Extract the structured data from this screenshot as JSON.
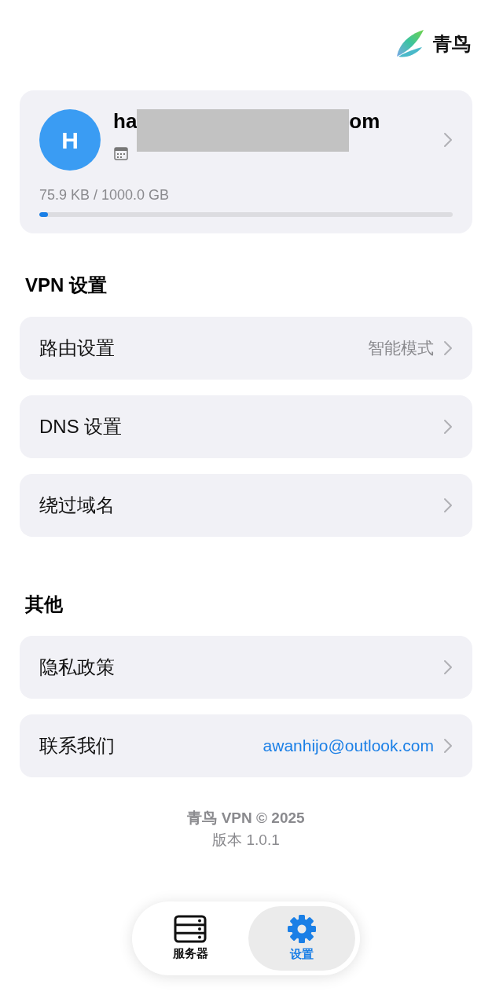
{
  "header": {
    "brand": "青鸟"
  },
  "account": {
    "avatar": "H",
    "email_start": "ha",
    "email_end": "om",
    "usage": "75.9 KB / 1000.0 GB",
    "level": 0.02
  },
  "sections": [
    {
      "title": "VPN 设置",
      "rows": [
        {
          "label": "路由设置",
          "value": "智能模式",
          "kind": "plain"
        },
        {
          "label": "DNS 设置"
        },
        {
          "label": "绕过域名"
        }
      ]
    },
    {
      "title": "其他",
      "rows": [
        {
          "label": "隐私政策"
        },
        {
          "label": "联系我们",
          "value": "awanhijo@outlook.com",
          "kind": "link"
        }
      ]
    }
  ],
  "footer": {
    "copyright": "青鸟 VPN © 2025",
    "version": "版本 1.0.1"
  },
  "tabs": [
    {
      "label": "服务器",
      "kind": "server",
      "selected": false
    },
    {
      "label": "设置",
      "kind": "gear",
      "selected": true
    }
  ]
}
